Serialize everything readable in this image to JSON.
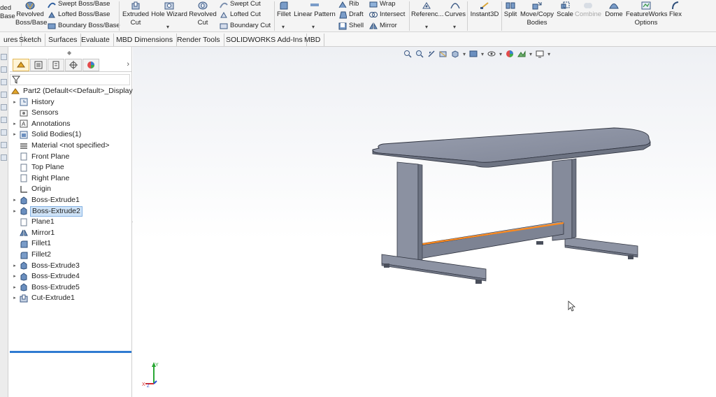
{
  "ribbon": {
    "extruded_boss_partial": "ded",
    "base_partial": "Base",
    "revolved_boss": "Revolved\nBoss/Base",
    "swept_boss": "Swept Boss/Base",
    "lofted_boss": "Lofted Boss/Base",
    "boundary_boss": "Boundary Boss/Base",
    "extruded_cut": "Extruded\nCut",
    "hole_wizard": "Hole Wizard",
    "revolved_cut": "Revolved\nCut",
    "swept_cut": "Swept Cut",
    "lofted_cut": "Lofted Cut",
    "boundary_cut": "Boundary Cut",
    "fillet": "Fillet",
    "linear_pattern": "Linear Pattern",
    "rib": "Rib",
    "draft": "Draft",
    "shell": "Shell",
    "wrap": "Wrap",
    "intersect": "Intersect",
    "mirror": "Mirror",
    "reference": "Referenc...",
    "curves": "Curves",
    "instant3d": "Instant3D",
    "split": "Split",
    "move_copy": "Move/Copy\nBodies",
    "scale": "Scale",
    "combine": "Combine",
    "dome": "Dome",
    "featureworks": "FeatureWorks\nOptions",
    "flex": "Flex"
  },
  "tabs": [
    "ures",
    "Sketch",
    "Surfaces",
    "Evaluate",
    "MBD Dimensions",
    "Render Tools",
    "SOLIDWORKS Add-Ins",
    "MBD"
  ],
  "tree": {
    "root": "Part2  (Default<<Default>_Display S",
    "nodes": [
      {
        "label": "History",
        "expand": true,
        "icon": "history-icon"
      },
      {
        "label": "Sensors",
        "expand": false,
        "icon": "sensors-icon"
      },
      {
        "label": "Annotations",
        "expand": true,
        "icon": "annotations-icon"
      },
      {
        "label": "Solid Bodies(1)",
        "expand": true,
        "icon": "solid-bodies-icon"
      },
      {
        "label": "Material <not specified>",
        "expand": false,
        "icon": "material-icon"
      },
      {
        "label": "Front Plane",
        "expand": false,
        "icon": "plane-icon"
      },
      {
        "label": "Top Plane",
        "expand": false,
        "icon": "plane-icon"
      },
      {
        "label": "Right Plane",
        "expand": false,
        "icon": "plane-icon"
      },
      {
        "label": "Origin",
        "expand": false,
        "icon": "origin-icon"
      },
      {
        "label": "Boss-Extrude1",
        "expand": true,
        "icon": "extrude-icon"
      },
      {
        "label": "Boss-Extrude2",
        "expand": true,
        "icon": "extrude-icon",
        "selected": true
      },
      {
        "label": "Plane1",
        "expand": false,
        "icon": "plane-icon"
      },
      {
        "label": "Mirror1",
        "expand": false,
        "icon": "mirror-icon"
      },
      {
        "label": "Fillet1",
        "expand": false,
        "icon": "fillet-icon"
      },
      {
        "label": "Fillet2",
        "expand": false,
        "icon": "fillet-icon"
      },
      {
        "label": "Boss-Extrude3",
        "expand": true,
        "icon": "extrude-icon"
      },
      {
        "label": "Boss-Extrude4",
        "expand": true,
        "icon": "extrude-icon"
      },
      {
        "label": "Boss-Extrude5",
        "expand": true,
        "icon": "extrude-icon"
      },
      {
        "label": "Cut-Extrude1",
        "expand": true,
        "icon": "cut-extrude-icon"
      }
    ]
  },
  "triad": {
    "x": "X",
    "y": "Y",
    "z": "Z"
  },
  "colors": {
    "model_face": "#8d93a3",
    "model_edge": "#303440",
    "highlight_edge": "#ff8a1c",
    "selection": "#cfe3f7",
    "rollback": "#2f7bd1"
  }
}
